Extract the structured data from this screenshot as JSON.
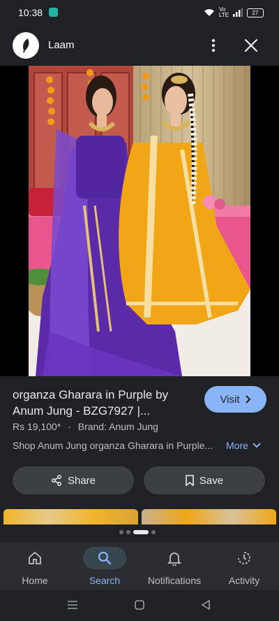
{
  "status_bar": {
    "time": "10:38",
    "network": "Vo LTE",
    "battery": "27"
  },
  "header": {
    "site_name": "Laam"
  },
  "result": {
    "title": "organza Gharara in Purple by Anum Jung - BZG7927 |...",
    "visit_label": "Visit",
    "price": "Rs 19,100*",
    "brand": "Brand: Anum Jung",
    "separator": "·",
    "description": "Shop Anum Jung organza Gharara in Purple...",
    "more_label": "More"
  },
  "actions": {
    "share_label": "Share",
    "save_label": "Save"
  },
  "pager": {
    "pages": 4,
    "active_index": 1
  },
  "bottom_nav": {
    "items": [
      {
        "label": "Home",
        "icon": "home-icon"
      },
      {
        "label": "Search",
        "icon": "search-icon",
        "active": true
      },
      {
        "label": "Notifications",
        "icon": "bell-icon"
      },
      {
        "label": "Activity",
        "icon": "activity-icon"
      }
    ]
  },
  "colors": {
    "accent": "#8ab4f8",
    "background": "#1f2125",
    "button": "#3c4043",
    "dress_purple": "#5b2aa8",
    "dress_yellow": "#f0a617"
  }
}
